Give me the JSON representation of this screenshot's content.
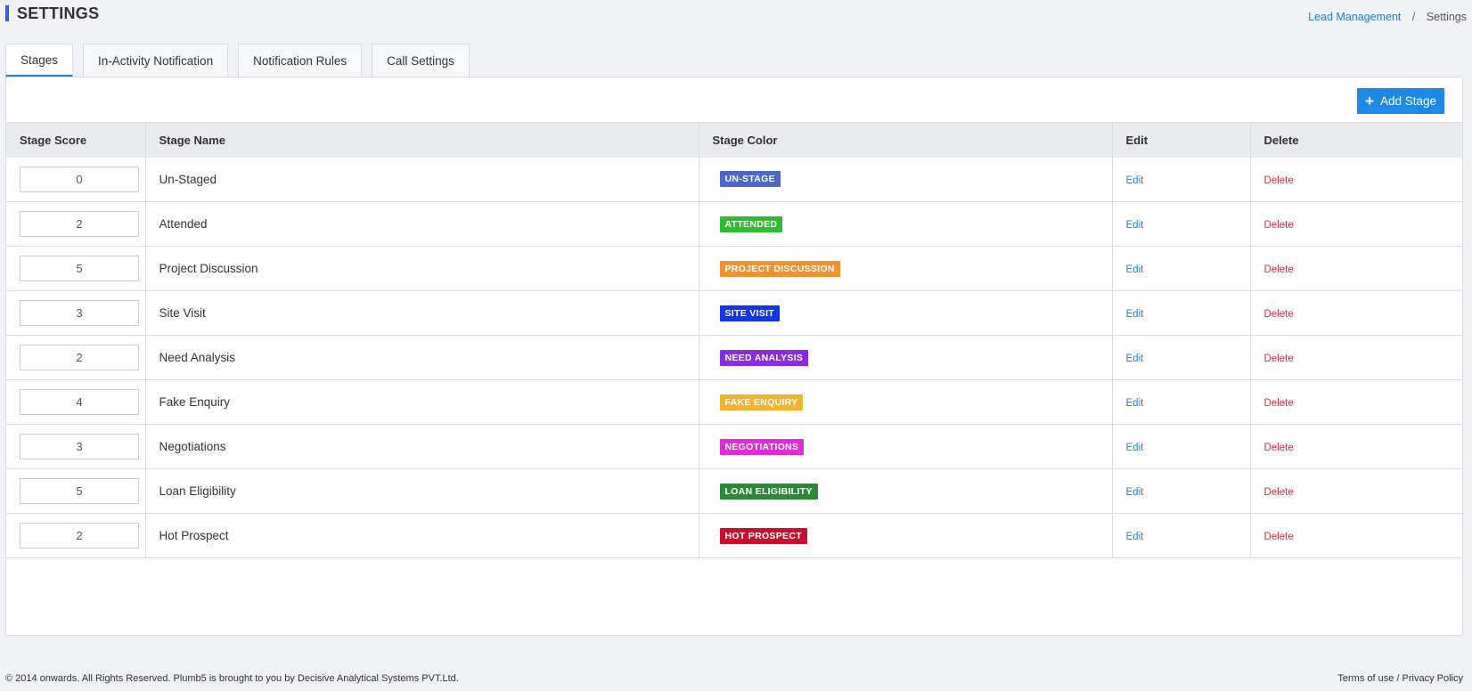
{
  "header": {
    "title": "SETTINGS",
    "breadcrumb": {
      "parent": "Lead Management",
      "separator": "/",
      "current": "Settings"
    }
  },
  "tabs": [
    {
      "label": "Stages",
      "active": true
    },
    {
      "label": "In-Activity Notification",
      "active": false
    },
    {
      "label": "Notification Rules",
      "active": false
    },
    {
      "label": "Call Settings",
      "active": false
    }
  ],
  "toolbar": {
    "add_label": "Add Stage",
    "add_icon": "plus-icon"
  },
  "table": {
    "columns": [
      "Stage Score",
      "Stage Name",
      "Stage Color",
      "Edit",
      "Delete"
    ],
    "edit_label": "Edit",
    "delete_label": "Delete",
    "rows": [
      {
        "score": "0",
        "name": "Un-Staged",
        "badge": "UN-STAGE",
        "color": "#4a67c9"
      },
      {
        "score": "2",
        "name": "Attended",
        "badge": "ATTENDED",
        "color": "#2ebd2e"
      },
      {
        "score": "5",
        "name": "Project Discussion",
        "badge": "PROJECT DISCUSSION",
        "color": "#f0922e"
      },
      {
        "score": "3",
        "name": "Site Visit",
        "badge": "SITE VISIT",
        "color": "#1036e6"
      },
      {
        "score": "2",
        "name": "Need Analysis",
        "badge": "NEED ANALYSIS",
        "color": "#8a2be2"
      },
      {
        "score": "4",
        "name": "Fake Enquiry",
        "badge": "FAKE ENQUIRY",
        "color": "#f0b42e"
      },
      {
        "score": "3",
        "name": "Negotiations",
        "badge": "NEGOTIATIONS",
        "color": "#e02bd6"
      },
      {
        "score": "5",
        "name": "Loan Eligibility",
        "badge": "LOAN ELIGIBILITY",
        "color": "#2a8a35"
      },
      {
        "score": "2",
        "name": "Hot Prospect",
        "badge": "HOT PROSPECT",
        "color": "#c8102e"
      }
    ]
  },
  "footer": {
    "copyright": "© 2014 onwards. All Rights Reserved. Plumb5 is brought to you by Decisive Analytical Systems PVT.Ltd.",
    "terms": "Terms of use",
    "separator": " / ",
    "privacy": "Privacy Policy"
  },
  "colors": {
    "accent": "#1e88e5",
    "link": "#1e7fd6",
    "delete": "#e02b3c"
  }
}
